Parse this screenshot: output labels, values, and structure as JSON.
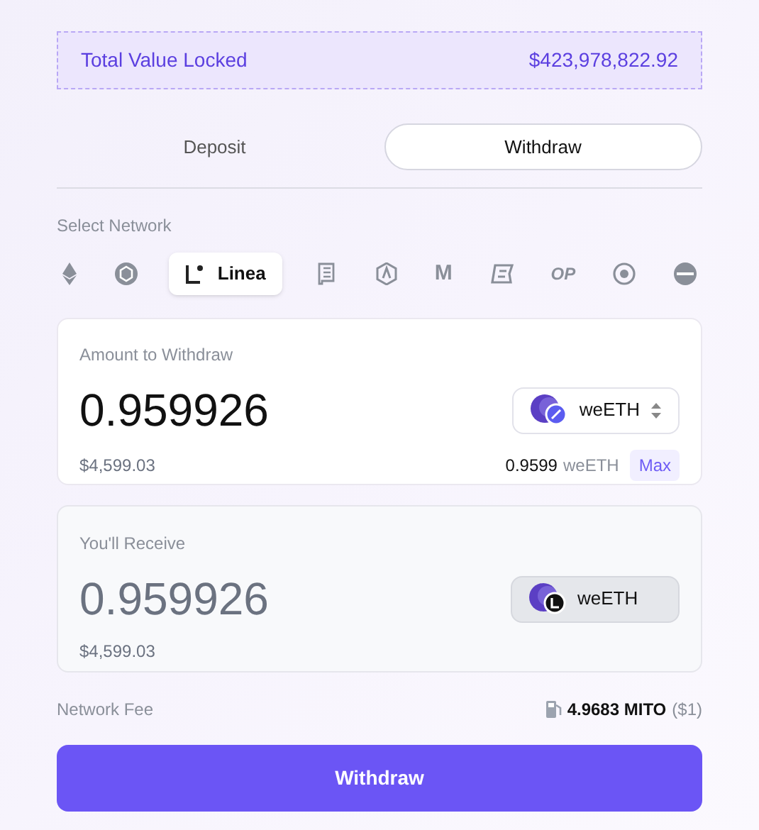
{
  "tvl": {
    "label": "Total Value Locked",
    "value": "$423,978,822.92"
  },
  "tabs": [
    {
      "label": "Deposit",
      "selected": false
    },
    {
      "label": "Withdraw",
      "selected": true
    }
  ],
  "network": {
    "label": "Select Network",
    "items": [
      {
        "kind": "eth",
        "selected": false
      },
      {
        "kind": "cube",
        "selected": false
      },
      {
        "kind": "linea",
        "label": "Linea",
        "selected": true
      },
      {
        "kind": "scroll",
        "selected": false
      },
      {
        "kind": "arbitrum",
        "selected": false
      },
      {
        "kind": "text",
        "label": "M",
        "selected": false
      },
      {
        "kind": "bsquare",
        "selected": false
      },
      {
        "kind": "text",
        "label": "OP",
        "selected": false
      },
      {
        "kind": "target",
        "selected": false
      },
      {
        "kind": "disc",
        "selected": false
      }
    ]
  },
  "amount": {
    "label": "Amount to Withdraw",
    "value": "0.959926",
    "usd": "$4,599.03",
    "token": "weETH",
    "balance": "0.9599",
    "balance_token": "weETH",
    "max": "Max"
  },
  "receive": {
    "label": "You'll Receive",
    "value": "0.959926",
    "usd": "$4,599.03",
    "token": "weETH"
  },
  "fee": {
    "label": "Network Fee",
    "amount": "4.9683 MITO",
    "usd": "($1)"
  },
  "submit": "Withdraw"
}
